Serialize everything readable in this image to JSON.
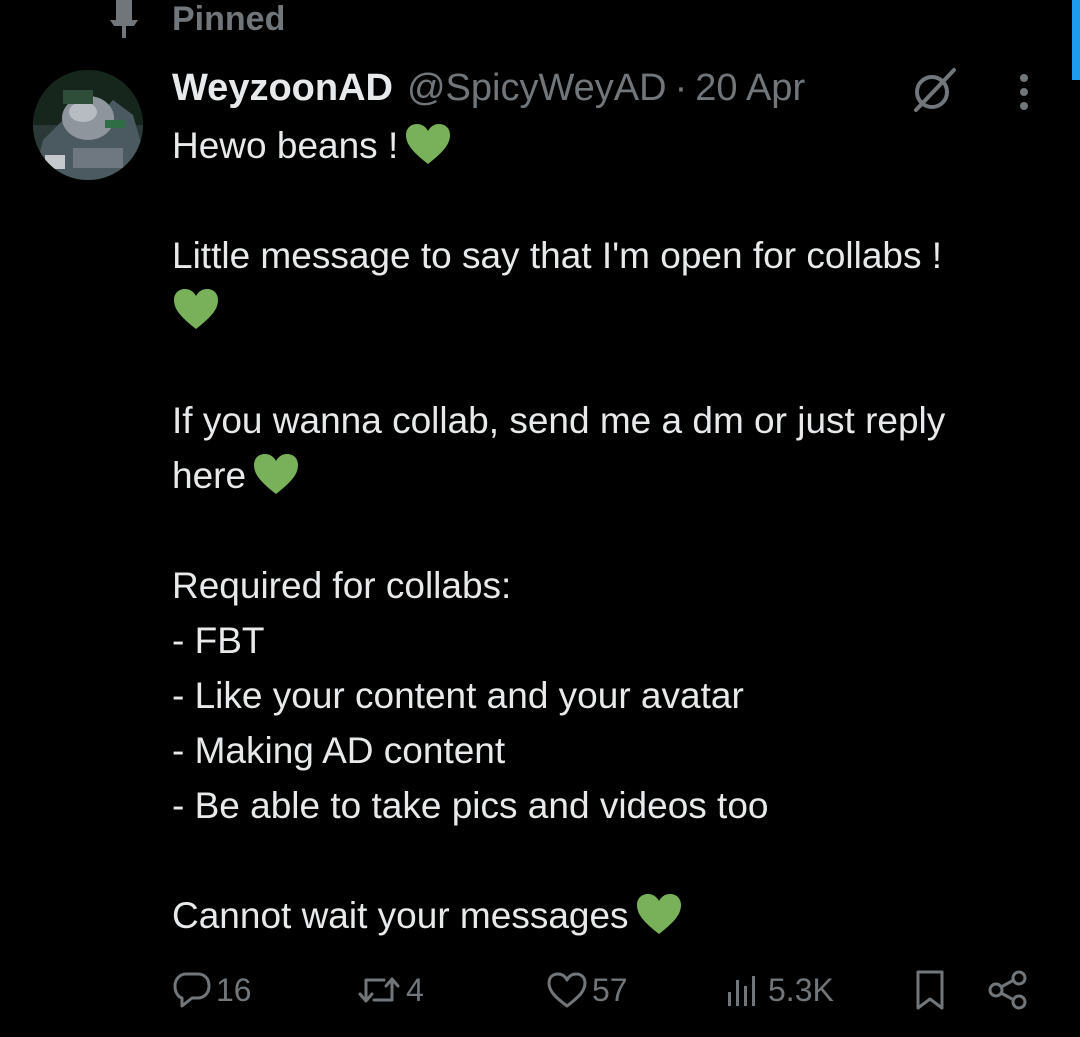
{
  "pinned": {
    "label": "Pinned",
    "icon": "pin-icon"
  },
  "tweet": {
    "author": {
      "display_name": "WeyzoonAD",
      "handle": "@SpicyWeyAD",
      "avatar_icon": "avatar-image"
    },
    "separator": "·",
    "date": "20 Apr",
    "greeting": "Hewo beans !",
    "message": "Little message to say that I'm open for collabs !",
    "dm_line_1": "If you wanna collab, send me a dm or just reply",
    "dm_line_2": "here",
    "required_heading": "Required for collabs:",
    "requirements": [
      "- FBT",
      "- Like your content and your avatar",
      "- Making AD content",
      "- Be able to take pics and videos too"
    ],
    "closing": "Cannot wait your messages",
    "emoji": "green-heart"
  },
  "actions": {
    "replies": "16",
    "reposts": "4",
    "likes": "57",
    "views": "5.3K",
    "bookmark_icon": "bookmark-icon",
    "share_icon": "share-icon"
  },
  "colors": {
    "background": "#000000",
    "primary_text": "#e7e9ea",
    "secondary_text": "#71767b",
    "accent": "#1d9bf0",
    "green_heart": "#78b159"
  }
}
